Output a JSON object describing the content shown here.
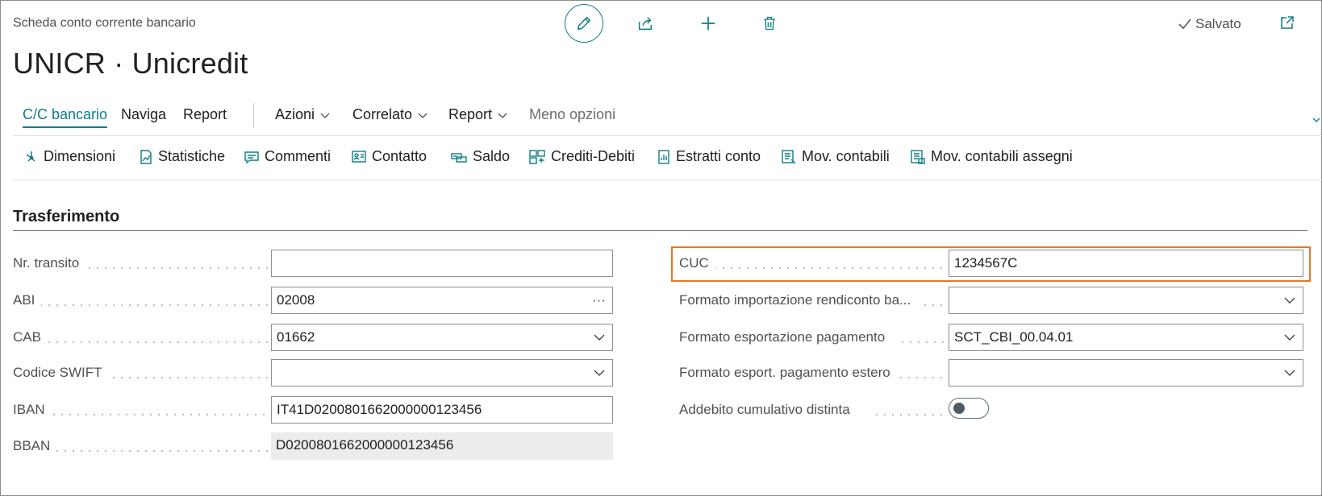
{
  "header": {
    "caption": "Scheda conto corrente bancario",
    "title": "UNICR · Unicredit",
    "saved_label": "Salvato"
  },
  "top_actions": [
    "edit-icon",
    "share-icon",
    "plus-icon",
    "trash-icon"
  ],
  "nav": {
    "items": [
      {
        "label": "C/C bancario",
        "active": true
      },
      {
        "label": "Naviga"
      },
      {
        "label": "Report"
      },
      {
        "label": "Azioni",
        "dropdown": true
      },
      {
        "label": "Correlato",
        "dropdown": true
      },
      {
        "label": "Report",
        "dropdown": true
      },
      {
        "label": "Meno opzioni",
        "muted": true
      }
    ]
  },
  "actions": [
    {
      "label": "Dimensioni",
      "icon": "dimensions-icon"
    },
    {
      "label": "Statistiche",
      "icon": "statistics-icon"
    },
    {
      "label": "Commenti",
      "icon": "comments-icon"
    },
    {
      "label": "Contatto",
      "icon": "contact-icon"
    },
    {
      "label": "Saldo",
      "icon": "balance-icon"
    },
    {
      "label": "Crediti-Debiti",
      "icon": "credits-debits-icon"
    },
    {
      "label": "Estratti conto",
      "icon": "statements-icon"
    },
    {
      "label": "Mov. contabili",
      "icon": "ledger-entries-icon"
    },
    {
      "label": "Mov. contabili assegni",
      "icon": "check-ledger-entries-icon"
    }
  ],
  "section": {
    "title": "Trasferimento",
    "left_fields": [
      {
        "label": "Nr. transito",
        "value": ""
      },
      {
        "label": "ABI",
        "value": "02008",
        "control": "ellipsis"
      },
      {
        "label": "CAB",
        "value": "01662",
        "control": "dropdown"
      },
      {
        "label": "Codice SWIFT",
        "value": "",
        "control": "dropdown"
      },
      {
        "label": "IBAN",
        "value": "IT41D0200801662000000123456"
      },
      {
        "label": "BBAN",
        "value": "D0200801662000000123456",
        "readonly": true
      }
    ],
    "right_fields": [
      {
        "label": "CUC",
        "value": "1234567C",
        "highlighted": true
      },
      {
        "label": "Formato importazione rendiconto ba...",
        "value": "",
        "control": "dropdown"
      },
      {
        "label": "Formato esportazione pagamento",
        "value": "SCT_CBI_00.04.01",
        "control": "dropdown"
      },
      {
        "label": "Formato esport. pagamento estero",
        "value": "",
        "control": "dropdown"
      },
      {
        "label": "Addebito cumulativo distinta",
        "toggle": false
      }
    ]
  },
  "colors": {
    "accent": "#0d7d84",
    "highlight": "#e87722",
    "readonly_bg": "#ececec"
  }
}
